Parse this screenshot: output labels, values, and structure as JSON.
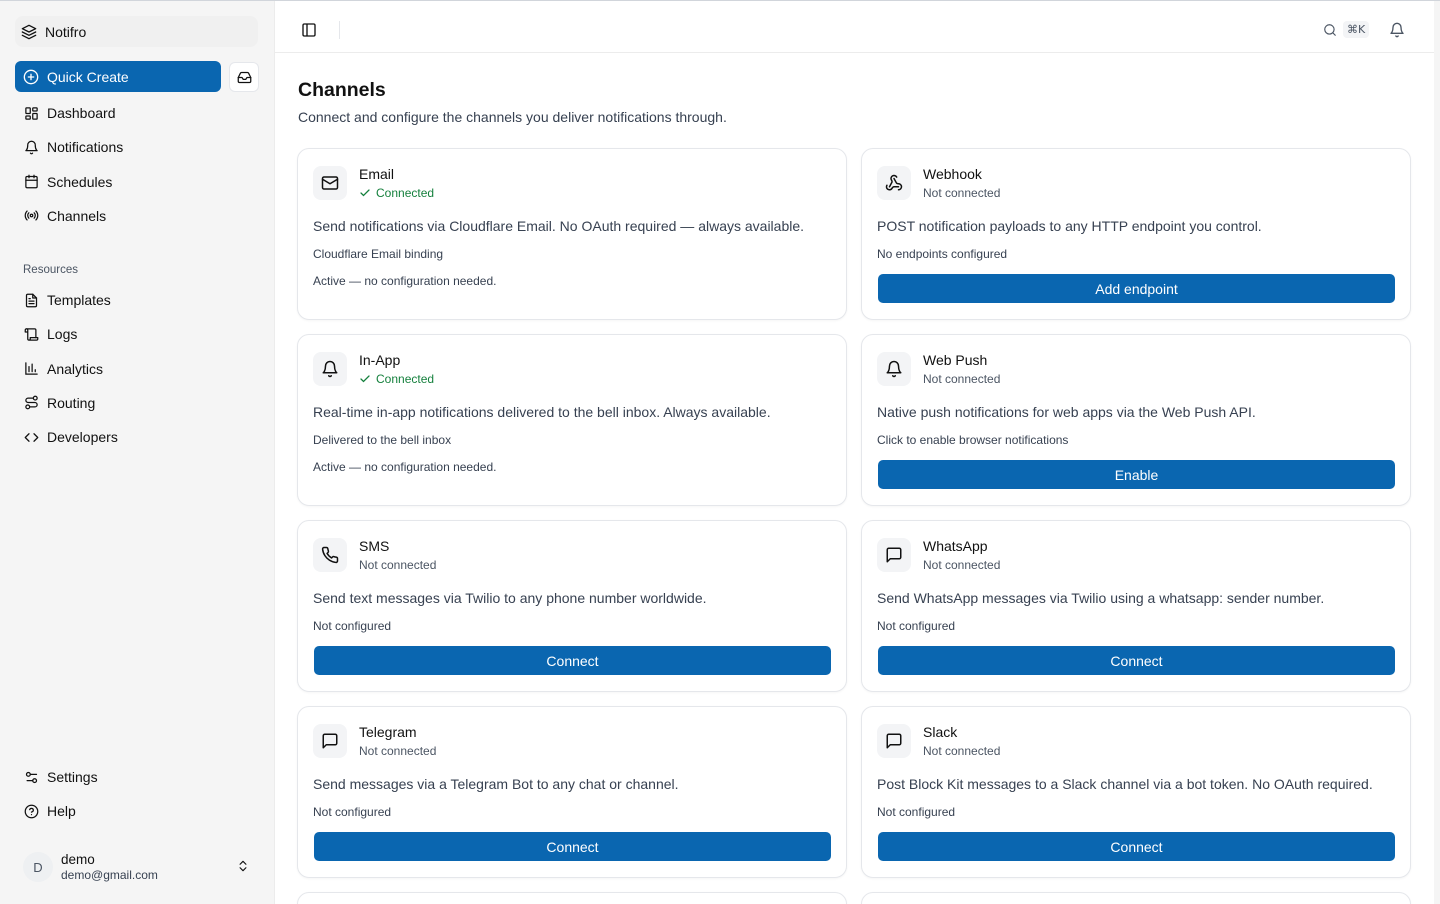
{
  "app": {
    "name": "Notifro"
  },
  "sidebar": {
    "quick_create": "Quick Create",
    "main_items": [
      {
        "label": "Dashboard",
        "icon": "dashboard-icon"
      },
      {
        "label": "Notifications",
        "icon": "bell-icon"
      },
      {
        "label": "Schedules",
        "icon": "calendar-icon"
      },
      {
        "label": "Channels",
        "icon": "radio-icon"
      }
    ],
    "resources_label": "Resources",
    "resource_items": [
      {
        "label": "Templates",
        "icon": "file-text-icon"
      },
      {
        "label": "Logs",
        "icon": "scroll-icon"
      },
      {
        "label": "Analytics",
        "icon": "bar-chart-icon"
      },
      {
        "label": "Routing",
        "icon": "route-icon"
      },
      {
        "label": "Developers",
        "icon": "code-icon"
      }
    ],
    "footer_items": [
      {
        "label": "Settings",
        "icon": "settings-icon"
      },
      {
        "label": "Help",
        "icon": "help-icon"
      }
    ],
    "user": {
      "initial": "D",
      "name": "demo",
      "email": "demo@gmail.com"
    }
  },
  "topbar": {
    "shortcut": "⌘K"
  },
  "page": {
    "title": "Channels",
    "subtitle": "Connect and configure the channels you deliver notifications through."
  },
  "channels": [
    {
      "title": "Email",
      "status": "Connected",
      "connected": true,
      "icon": "mail-icon",
      "description": "Send notifications via Cloudflare Email. No OAuth required — always available.",
      "meta": "Cloudflare Email binding",
      "note": "Active — no configuration needed."
    },
    {
      "title": "Webhook",
      "status": "Not connected",
      "connected": false,
      "icon": "webhook-icon",
      "description": "POST notification payloads to any HTTP endpoint you control.",
      "meta": "No endpoints configured",
      "button": "Add endpoint"
    },
    {
      "title": "In-App",
      "status": "Connected",
      "connected": true,
      "icon": "bell-icon",
      "description": "Real-time in-app notifications delivered to the bell inbox. Always available.",
      "meta": "Delivered to the bell inbox",
      "note": "Active — no configuration needed."
    },
    {
      "title": "Web Push",
      "status": "Not connected",
      "connected": false,
      "icon": "bell-icon",
      "description": "Native push notifications for web apps via the Web Push API.",
      "meta": "Click to enable browser notifications",
      "button": "Enable"
    },
    {
      "title": "SMS",
      "status": "Not connected",
      "connected": false,
      "icon": "phone-icon",
      "description": "Send text messages via Twilio to any phone number worldwide.",
      "meta": "Not configured",
      "button": "Connect"
    },
    {
      "title": "WhatsApp",
      "status": "Not connected",
      "connected": false,
      "icon": "message-square-icon",
      "description": "Send WhatsApp messages via Twilio using a whatsapp: sender number.",
      "meta": "Not configured",
      "button": "Connect"
    },
    {
      "title": "Telegram",
      "status": "Not connected",
      "connected": false,
      "icon": "message-square-icon",
      "description": "Send messages via a Telegram Bot to any chat or channel.",
      "meta": "Not configured",
      "button": "Connect"
    },
    {
      "title": "Slack",
      "status": "Not connected",
      "connected": false,
      "icon": "message-square-icon",
      "description": "Post Block Kit messages to a Slack channel via a bot token. No OAuth required.",
      "meta": "Not configured",
      "button": "Connect"
    }
  ],
  "colors": {
    "accent": "#0a66b0",
    "connected": "#15803d"
  }
}
